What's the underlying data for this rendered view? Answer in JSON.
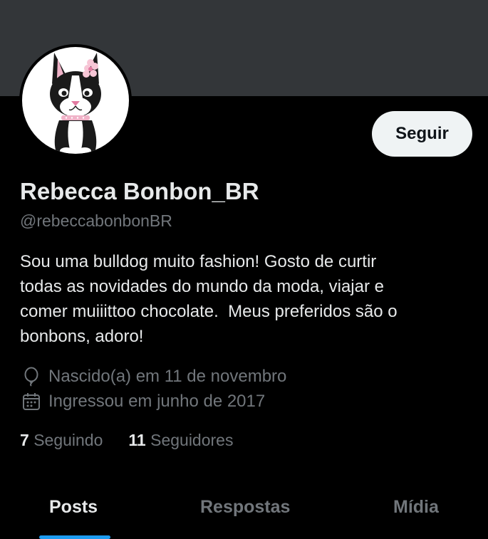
{
  "profile": {
    "display_name": "Rebecca Bonbon_BR",
    "handle": "@rebeccabonbonBR",
    "bio": "Sou uma bulldog muito fashion! Gosto de curtir\ntodas as novidades do mundo da moda, viajar e\ncomer muiiittoo chocolate.  Meus preferidos são o\nbonbons, adoro!",
    "birth_text": "Nascido(a) em 11 de novembro",
    "joined_text": "Ingressou em junho de 2017",
    "birth_icon": "balloon-icon",
    "joined_icon": "calendar-icon"
  },
  "actions": {
    "follow_label": "Seguir"
  },
  "stats": {
    "following_count": "7",
    "following_label": "Seguindo",
    "followers_count": "11",
    "followers_label": "Seguidores"
  },
  "tabs": [
    {
      "label": "Posts",
      "active": true
    },
    {
      "label": "Respostas",
      "active": false
    },
    {
      "label": "Mídia",
      "active": false
    }
  ],
  "colors": {
    "background": "#000000",
    "banner": "#333639",
    "text_primary": "#e7e9ea",
    "text_secondary": "#71767b",
    "accent": "#1d9bf0",
    "button_bg": "#eff3f4"
  }
}
